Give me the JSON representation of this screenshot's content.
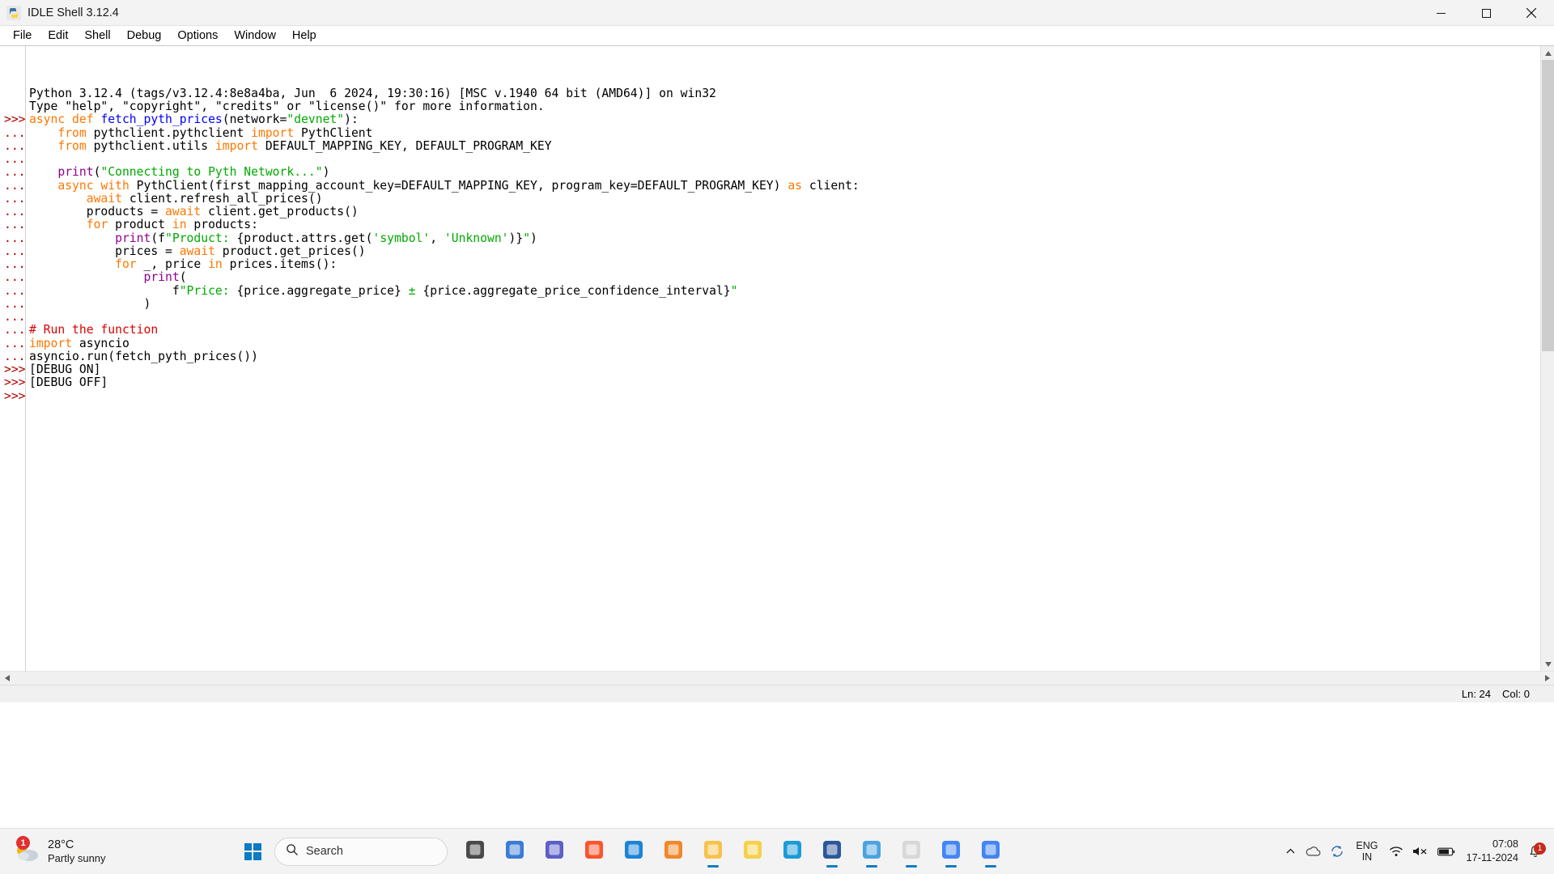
{
  "window": {
    "title": "IDLE Shell 3.12.4",
    "app_icon": "python-idle-icon",
    "minimize_label": "–",
    "maximize_label": "❐",
    "close_label": "✕"
  },
  "menu": {
    "items": [
      {
        "label": "File"
      },
      {
        "label": "Edit"
      },
      {
        "label": "Shell"
      },
      {
        "label": "Debug"
      },
      {
        "label": "Options"
      },
      {
        "label": "Window"
      },
      {
        "label": "Help"
      }
    ]
  },
  "shell": {
    "lines": [
      {
        "prompt": "",
        "tokens": [
          {
            "t": "Python 3.12.4 (tags/v3.12.4:8e8a4ba, Jun  6 2024, 19:30:16) [MSC v.1940 64 bit (AMD64)] on win32",
            "c": "plain"
          }
        ]
      },
      {
        "prompt": "",
        "tokens": [
          {
            "t": "Type \"help\", \"copyright\", \"credits\" or \"license()\" for more information.",
            "c": "plain"
          }
        ]
      },
      {
        "prompt": ">>>",
        "tokens": [
          {
            "t": "async def ",
            "c": "kw"
          },
          {
            "t": "fetch_pyth_prices",
            "c": "dfn"
          },
          {
            "t": "(network=",
            "c": "plain"
          },
          {
            "t": "\"devnet\"",
            "c": "str"
          },
          {
            "t": "):",
            "c": "plain"
          }
        ]
      },
      {
        "prompt": "...",
        "tokens": [
          {
            "t": "    ",
            "c": "plain"
          },
          {
            "t": "from ",
            "c": "kw"
          },
          {
            "t": "pythclient.pythclient ",
            "c": "plain"
          },
          {
            "t": "import ",
            "c": "kw"
          },
          {
            "t": "PythClient",
            "c": "plain"
          }
        ]
      },
      {
        "prompt": "...",
        "tokens": [
          {
            "t": "    ",
            "c": "plain"
          },
          {
            "t": "from ",
            "c": "kw"
          },
          {
            "t": "pythclient.utils ",
            "c": "plain"
          },
          {
            "t": "import ",
            "c": "kw"
          },
          {
            "t": "DEFAULT_MAPPING_KEY, DEFAULT_PROGRAM_KEY",
            "c": "plain"
          }
        ]
      },
      {
        "prompt": "...",
        "tokens": [
          {
            "t": "",
            "c": "plain"
          }
        ]
      },
      {
        "prompt": "...",
        "tokens": [
          {
            "t": "    ",
            "c": "plain"
          },
          {
            "t": "print",
            "c": "bltn"
          },
          {
            "t": "(",
            "c": "plain"
          },
          {
            "t": "\"Connecting to Pyth Network...\"",
            "c": "str"
          },
          {
            "t": ")",
            "c": "plain"
          }
        ]
      },
      {
        "prompt": "...",
        "tokens": [
          {
            "t": "    ",
            "c": "plain"
          },
          {
            "t": "async with ",
            "c": "kw"
          },
          {
            "t": "PythClient(first_mapping_account_key=DEFAULT_MAPPING_KEY, program_key=DEFAULT_PROGRAM_KEY) ",
            "c": "plain"
          },
          {
            "t": "as ",
            "c": "kw"
          },
          {
            "t": "client:",
            "c": "plain"
          }
        ]
      },
      {
        "prompt": "...",
        "tokens": [
          {
            "t": "        ",
            "c": "plain"
          },
          {
            "t": "await ",
            "c": "kw"
          },
          {
            "t": "client.refresh_all_prices()",
            "c": "plain"
          }
        ]
      },
      {
        "prompt": "...",
        "tokens": [
          {
            "t": "        products = ",
            "c": "plain"
          },
          {
            "t": "await ",
            "c": "kw"
          },
          {
            "t": "client.get_products()",
            "c": "plain"
          }
        ]
      },
      {
        "prompt": "...",
        "tokens": [
          {
            "t": "        ",
            "c": "plain"
          },
          {
            "t": "for ",
            "c": "kw"
          },
          {
            "t": "product ",
            "c": "plain"
          },
          {
            "t": "in ",
            "c": "kw"
          },
          {
            "t": "products:",
            "c": "plain"
          }
        ]
      },
      {
        "prompt": "...",
        "tokens": [
          {
            "t": "            ",
            "c": "plain"
          },
          {
            "t": "print",
            "c": "bltn"
          },
          {
            "t": "(f",
            "c": "plain"
          },
          {
            "t": "\"Product: ",
            "c": "str"
          },
          {
            "t": "{product.attrs.get(",
            "c": "plain"
          },
          {
            "t": "'symbol'",
            "c": "str"
          },
          {
            "t": ", ",
            "c": "plain"
          },
          {
            "t": "'Unknown'",
            "c": "str"
          },
          {
            "t": ")}",
            "c": "plain"
          },
          {
            "t": "\"",
            "c": "str"
          },
          {
            "t": ")",
            "c": "plain"
          }
        ]
      },
      {
        "prompt": "...",
        "tokens": [
          {
            "t": "            prices = ",
            "c": "plain"
          },
          {
            "t": "await ",
            "c": "kw"
          },
          {
            "t": "product.get_prices()",
            "c": "plain"
          }
        ]
      },
      {
        "prompt": "...",
        "tokens": [
          {
            "t": "            ",
            "c": "plain"
          },
          {
            "t": "for ",
            "c": "kw"
          },
          {
            "t": "_, price ",
            "c": "plain"
          },
          {
            "t": "in ",
            "c": "kw"
          },
          {
            "t": "prices.items():",
            "c": "plain"
          }
        ]
      },
      {
        "prompt": "...",
        "tokens": [
          {
            "t": "                ",
            "c": "plain"
          },
          {
            "t": "print",
            "c": "bltn"
          },
          {
            "t": "(",
            "c": "plain"
          }
        ]
      },
      {
        "prompt": "...",
        "tokens": [
          {
            "t": "                    f",
            "c": "plain"
          },
          {
            "t": "\"Price: ",
            "c": "str"
          },
          {
            "t": "{price.aggregate_price}",
            "c": "plain"
          },
          {
            "t": " ± ",
            "c": "str"
          },
          {
            "t": "{price.aggregate_price_confidence_interval}",
            "c": "plain"
          },
          {
            "t": "\"",
            "c": "str"
          }
        ]
      },
      {
        "prompt": "...",
        "tokens": [
          {
            "t": "                )",
            "c": "plain"
          }
        ]
      },
      {
        "prompt": "...",
        "tokens": [
          {
            "t": "",
            "c": "plain"
          }
        ]
      },
      {
        "prompt": "...",
        "tokens": [
          {
            "t": "# Run the function",
            "c": "cmt"
          }
        ]
      },
      {
        "prompt": "...",
        "tokens": [
          {
            "t": "import ",
            "c": "kw"
          },
          {
            "t": "asyncio",
            "c": "plain"
          }
        ]
      },
      {
        "prompt": "...",
        "tokens": [
          {
            "t": "asyncio.run(fetch_pyth_prices())",
            "c": "plain"
          }
        ]
      },
      {
        "prompt": ">>>",
        "tokens": [
          {
            "t": "[DEBUG ON]",
            "c": "plain"
          }
        ]
      },
      {
        "prompt": ">>>",
        "tokens": [
          {
            "t": "[DEBUG OFF]",
            "c": "plain"
          }
        ]
      },
      {
        "prompt": ">>>",
        "tokens": [
          {
            "t": "",
            "c": "plain"
          }
        ]
      }
    ]
  },
  "statusbar": {
    "line_label": "Ln: 24",
    "col_label": "Col: 0"
  },
  "taskbar": {
    "weather": {
      "badge": "1",
      "temperature": "28°C",
      "description": "Partly sunny",
      "icon": "partly-sunny-icon"
    },
    "start": {
      "label": "Start",
      "icon": "windows-logo-icon"
    },
    "search": {
      "placeholder": "Search",
      "icon": "search-icon"
    },
    "apps": [
      {
        "name": "task-view",
        "icon": "task-view-icon",
        "color": "#4a4a4a",
        "running": false
      },
      {
        "name": "copilot",
        "icon": "copilot-icon",
        "color": "#3a7bd5",
        "running": false
      },
      {
        "name": "microsoft-teams",
        "icon": "teams-icon",
        "color": "#5b5fc7",
        "running": false
      },
      {
        "name": "brave-browser",
        "icon": "brave-icon",
        "color": "#fb542b",
        "running": false
      },
      {
        "name": "microsoft-store",
        "icon": "store-icon",
        "color": "#1b84d8",
        "running": false
      },
      {
        "name": "vlc-media-player",
        "icon": "vlc-icon",
        "color": "#f0872a",
        "running": false
      },
      {
        "name": "file-explorer",
        "icon": "folder-icon",
        "color": "#f7c14b",
        "running": true
      },
      {
        "name": "pycharm",
        "icon": "pycharm-icon",
        "color": "#f5d04c",
        "running": false
      },
      {
        "name": "microsoft-edge",
        "icon": "edge-icon",
        "color": "#1a9bd7",
        "running": false
      },
      {
        "name": "microsoft-word",
        "icon": "word-icon",
        "color": "#2b579a",
        "running": true
      },
      {
        "name": "notepad",
        "icon": "notepad-icon",
        "color": "#4aa3df",
        "running": true
      },
      {
        "name": "python-idle",
        "icon": "python-idle-icon",
        "color": "#d8d8d8",
        "running": true
      },
      {
        "name": "google-chrome",
        "icon": "chrome-icon",
        "color": "#4285f4",
        "running": true
      },
      {
        "name": "google-chrome-2",
        "icon": "chrome-icon",
        "color": "#4285f4",
        "running": true
      }
    ],
    "tray": {
      "chevron": "show-hidden-icons",
      "cloud": "onedrive-icon",
      "sync": "sync-icon",
      "language_line1": "ENG",
      "language_line2": "IN",
      "wifi": "wifi-icon",
      "volume": "volume-muted-icon",
      "battery": "battery-icon",
      "time": "07:08",
      "date": "17-11-2024",
      "notification_count": "1"
    }
  },
  "colors": {
    "keyword": "#ff7700",
    "string": "#00aa00",
    "builtin": "#900090",
    "definition": "#0000ff",
    "comment": "#dd0000",
    "prompt": "#b00000",
    "accent": "#0a7bc4"
  }
}
